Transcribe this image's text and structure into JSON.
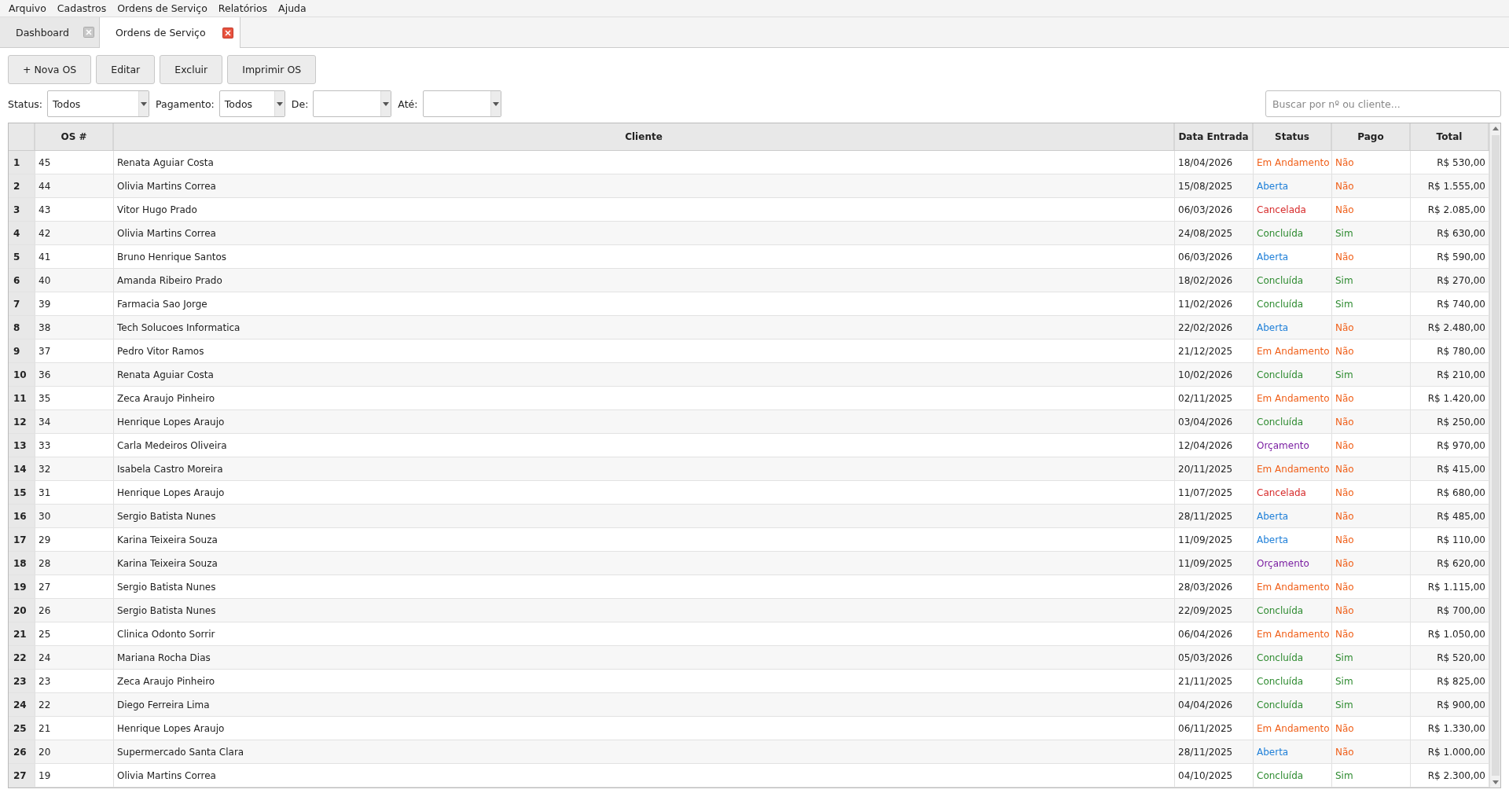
{
  "menu": [
    "Arquivo",
    "Cadastros",
    "Ordens de Serviço",
    "Relatórios",
    "Ajuda"
  ],
  "tabs": [
    {
      "label": "Dashboard",
      "selected": false
    },
    {
      "label": "Ordens de Serviço",
      "selected": true
    }
  ],
  "toolbar": [
    "+ Nova OS",
    "Editar",
    "Excluir",
    "Imprimir OS"
  ],
  "filters": [
    {
      "label": "Status:",
      "value": "Todos"
    },
    {
      "label": "Pagamento:",
      "value": "Todos"
    },
    {
      "label": "De:"
    },
    {
      "label": "Até:"
    }
  ],
  "search": {
    "placeholder": "Buscar por nº ou cliente..."
  },
  "table": {
    "columns": [
      "OS #",
      "Cliente",
      "Data Entrada",
      "Status",
      "Pago",
      "Total"
    ],
    "rows": [
      {
        "n": "1",
        "os": "45",
        "cliente": "Renata Aguiar Costa",
        "data": "18/04/2026",
        "status": "Em Andamento",
        "color": "#f0601a",
        "pago": "Não",
        "paid": false,
        "total": "R$ 530,00"
      },
      {
        "n": "2",
        "os": "44",
        "cliente": "Olivia Martins Correa",
        "data": "15/08/2025",
        "status": "Aberta",
        "color": "#1e7fd8",
        "pago": "Não",
        "paid": false,
        "total": "R$ 1.555,00"
      },
      {
        "n": "3",
        "os": "43",
        "cliente": "Vitor Hugo Prado",
        "data": "06/03/2026",
        "status": "Cancelada",
        "color": "#d62a2a",
        "pago": "Não",
        "paid": false,
        "total": "R$ 2.085,00"
      },
      {
        "n": "4",
        "os": "42",
        "cliente": "Olivia Martins Correa",
        "data": "24/08/2025",
        "status": "Concluída",
        "color": "#2e8b30",
        "pago": "Sim",
        "paid": true,
        "total": "R$ 630,00"
      },
      {
        "n": "5",
        "os": "41",
        "cliente": "Bruno Henrique Santos",
        "data": "06/03/2026",
        "status": "Aberta",
        "color": "#1e7fd8",
        "pago": "Não",
        "paid": false,
        "total": "R$ 590,00"
      },
      {
        "n": "6",
        "os": "40",
        "cliente": "Amanda Ribeiro Prado",
        "data": "18/02/2026",
        "status": "Concluída",
        "color": "#2e8b30",
        "pago": "Sim",
        "paid": true,
        "total": "R$ 270,00"
      },
      {
        "n": "7",
        "os": "39",
        "cliente": "Farmacia Sao Jorge",
        "data": "11/02/2026",
        "status": "Concluída",
        "color": "#2e8b30",
        "pago": "Sim",
        "paid": true,
        "total": "R$ 740,00"
      },
      {
        "n": "8",
        "os": "38",
        "cliente": "Tech Solucoes Informatica",
        "data": "22/02/2026",
        "status": "Aberta",
        "color": "#1e7fd8",
        "pago": "Não",
        "paid": false,
        "total": "R$ 2.480,00"
      },
      {
        "n": "9",
        "os": "37",
        "cliente": "Pedro Vitor Ramos",
        "data": "21/12/2025",
        "status": "Em Andamento",
        "color": "#f0601a",
        "pago": "Não",
        "paid": false,
        "total": "R$ 780,00"
      },
      {
        "n": "10",
        "os": "36",
        "cliente": "Renata Aguiar Costa",
        "data": "10/02/2026",
        "status": "Concluída",
        "color": "#2e8b30",
        "pago": "Sim",
        "paid": true,
        "total": "R$ 210,00"
      },
      {
        "n": "11",
        "os": "35",
        "cliente": "Zeca Araujo Pinheiro",
        "data": "02/11/2025",
        "status": "Em Andamento",
        "color": "#f0601a",
        "pago": "Não",
        "paid": false,
        "total": "R$ 1.420,00"
      },
      {
        "n": "12",
        "os": "34",
        "cliente": "Henrique Lopes Araujo",
        "data": "03/04/2026",
        "status": "Concluída",
        "color": "#2e8b30",
        "pago": "Não",
        "paid": false,
        "total": "R$ 250,00"
      },
      {
        "n": "13",
        "os": "33",
        "cliente": "Carla Medeiros Oliveira",
        "data": "12/04/2026",
        "status": "Orçamento",
        "color": "#7b1fa2",
        "pago": "Não",
        "paid": false,
        "total": "R$ 970,00"
      },
      {
        "n": "14",
        "os": "32",
        "cliente": "Isabela Castro Moreira",
        "data": "20/11/2025",
        "status": "Em Andamento",
        "color": "#f0601a",
        "pago": "Não",
        "paid": false,
        "total": "R$ 415,00"
      },
      {
        "n": "15",
        "os": "31",
        "cliente": "Henrique Lopes Araujo",
        "data": "11/07/2025",
        "status": "Cancelada",
        "color": "#d62a2a",
        "pago": "Não",
        "paid": false,
        "total": "R$ 680,00"
      },
      {
        "n": "16",
        "os": "30",
        "cliente": "Sergio Batista Nunes",
        "data": "28/11/2025",
        "status": "Aberta",
        "color": "#1e7fd8",
        "pago": "Não",
        "paid": false,
        "total": "R$ 485,00"
      },
      {
        "n": "17",
        "os": "29",
        "cliente": "Karina Teixeira Souza",
        "data": "11/09/2025",
        "status": "Aberta",
        "color": "#1e7fd8",
        "pago": "Não",
        "paid": false,
        "total": "R$ 110,00"
      },
      {
        "n": "18",
        "os": "28",
        "cliente": "Karina Teixeira Souza",
        "data": "11/09/2025",
        "status": "Orçamento",
        "color": "#7b1fa2",
        "pago": "Não",
        "paid": false,
        "total": "R$ 620,00"
      },
      {
        "n": "19",
        "os": "27",
        "cliente": "Sergio Batista Nunes",
        "data": "28/03/2026",
        "status": "Em Andamento",
        "color": "#f0601a",
        "pago": "Não",
        "paid": false,
        "total": "R$ 1.115,00"
      },
      {
        "n": "20",
        "os": "26",
        "cliente": "Sergio Batista Nunes",
        "data": "22/09/2025",
        "status": "Concluída",
        "color": "#2e8b30",
        "pago": "Não",
        "paid": false,
        "total": "R$ 700,00"
      },
      {
        "n": "21",
        "os": "25",
        "cliente": "Clinica Odonto Sorrir",
        "data": "06/04/2026",
        "status": "Em Andamento",
        "color": "#f0601a",
        "pago": "Não",
        "paid": false,
        "total": "R$ 1.050,00"
      },
      {
        "n": "22",
        "os": "24",
        "cliente": "Mariana Rocha Dias",
        "data": "05/03/2026",
        "status": "Concluída",
        "color": "#2e8b30",
        "pago": "Sim",
        "paid": true,
        "total": "R$ 520,00"
      },
      {
        "n": "23",
        "os": "23",
        "cliente": "Zeca Araujo Pinheiro",
        "data": "21/11/2025",
        "status": "Concluída",
        "color": "#2e8b30",
        "pago": "Sim",
        "paid": true,
        "total": "R$ 825,00"
      },
      {
        "n": "24",
        "os": "22",
        "cliente": "Diego Ferreira Lima",
        "data": "04/04/2026",
        "status": "Concluída",
        "color": "#2e8b30",
        "pago": "Sim",
        "paid": true,
        "total": "R$ 900,00"
      },
      {
        "n": "25",
        "os": "21",
        "cliente": "Henrique Lopes Araujo",
        "data": "06/11/2025",
        "status": "Em Andamento",
        "color": "#f0601a",
        "pago": "Não",
        "paid": false,
        "total": "R$ 1.330,00"
      },
      {
        "n": "26",
        "os": "20",
        "cliente": "Supermercado Santa Clara",
        "data": "28/11/2025",
        "status": "Aberta",
        "color": "#1e7fd8",
        "pago": "Não",
        "paid": false,
        "total": "R$ 1.000,00"
      },
      {
        "n": "27",
        "os": "19",
        "cliente": "Olivia Martins Correa",
        "data": "04/10/2025",
        "status": "Concluída",
        "color": "#2e8b30",
        "pago": "Sim",
        "paid": true,
        "total": "R$ 2.300,00"
      }
    ]
  }
}
